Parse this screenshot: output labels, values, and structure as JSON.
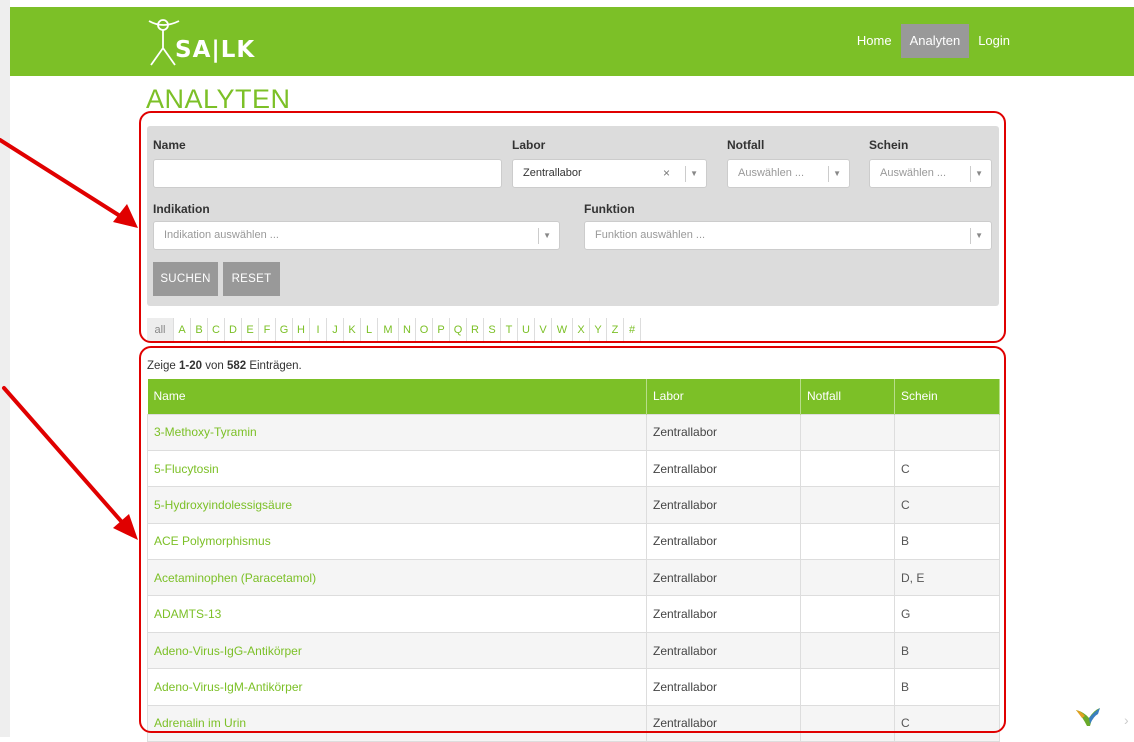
{
  "brand": {
    "logo_text": "SA|LK"
  },
  "nav": {
    "items": [
      {
        "label": "Home",
        "active": false
      },
      {
        "label": "Analyten",
        "active": true
      },
      {
        "label": "Login",
        "active": false
      }
    ]
  },
  "page": {
    "title": "ANALYTEN"
  },
  "filters": {
    "name": {
      "label": "Name",
      "value": ""
    },
    "labor": {
      "label": "Labor",
      "value": "Zentrallabor",
      "clear": "×"
    },
    "notfall": {
      "label": "Notfall",
      "placeholder": "Auswählen ..."
    },
    "schein": {
      "label": "Schein",
      "placeholder": "Auswählen ..."
    },
    "indikation": {
      "label": "Indikation",
      "placeholder": "Indikation auswählen ..."
    },
    "funktion": {
      "label": "Funktion",
      "placeholder": "Funktion auswählen ..."
    },
    "search_button": "SUCHEN",
    "reset_button": "RESET"
  },
  "alphabet": [
    "all",
    "A",
    "B",
    "C",
    "D",
    "E",
    "F",
    "G",
    "H",
    "I",
    "J",
    "K",
    "L",
    "M",
    "N",
    "O",
    "P",
    "Q",
    "R",
    "S",
    "T",
    "U",
    "V",
    "W",
    "X",
    "Y",
    "Z",
    "#"
  ],
  "alphabet_active": "all",
  "summary": {
    "prefix": "Zeige ",
    "range": "1-20",
    "middle": " von ",
    "total": "582",
    "suffix": " Einträgen."
  },
  "table": {
    "headers": [
      "Name",
      "Labor",
      "Notfall",
      "Schein"
    ],
    "rows": [
      {
        "name": "3-Methoxy-Tyramin",
        "labor": "Zentrallabor",
        "notfall": "",
        "schein": ""
      },
      {
        "name": "5-Flucytosin",
        "labor": "Zentrallabor",
        "notfall": "",
        "schein": "C"
      },
      {
        "name": "5-Hydroxyindolessigsäure",
        "labor": "Zentrallabor",
        "notfall": "",
        "schein": "C"
      },
      {
        "name": "ACE Polymorphismus",
        "labor": "Zentrallabor",
        "notfall": "",
        "schein": "B"
      },
      {
        "name": "Acetaminophen (Paracetamol)",
        "labor": "Zentrallabor",
        "notfall": "",
        "schein": "D, E"
      },
      {
        "name": "ADAMTS-13",
        "labor": "Zentrallabor",
        "notfall": "",
        "schein": "G"
      },
      {
        "name": "Adeno-Virus-IgG-Antikörper",
        "labor": "Zentrallabor",
        "notfall": "",
        "schein": "B"
      },
      {
        "name": "Adeno-Virus-IgM-Antikörper",
        "labor": "Zentrallabor",
        "notfall": "",
        "schein": "B"
      },
      {
        "name": "Adrenalin im Urin",
        "labor": "Zentrallabor",
        "notfall": "",
        "schein": "C"
      }
    ]
  },
  "colors": {
    "brand_green": "#7cc027",
    "active_gray": "#999999",
    "annotation_red": "#e00000"
  },
  "icons": {
    "logo": "vitruvian-figure-icon",
    "corner": "yii-logo-icon"
  }
}
